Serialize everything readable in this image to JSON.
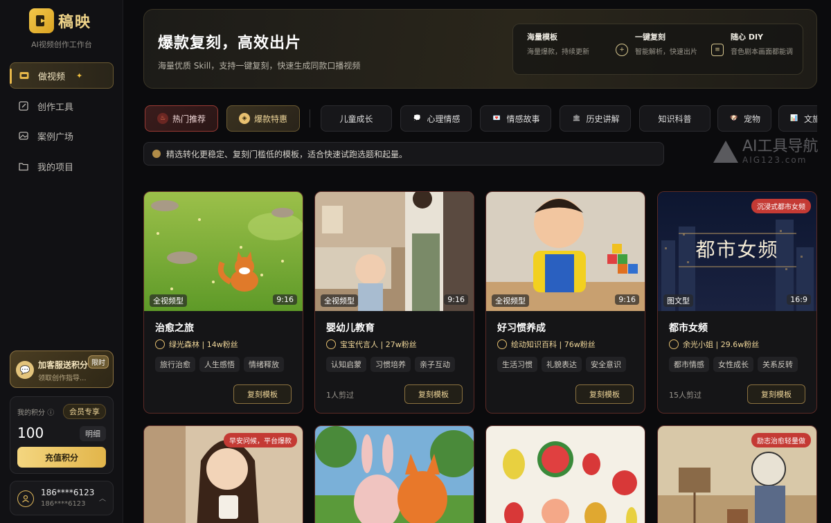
{
  "brand": {
    "name": "稿映",
    "subtitle": "AI视频创作工作台"
  },
  "nav": [
    {
      "label": "做视频",
      "icon": "video-icon"
    },
    {
      "label": "创作工具",
      "icon": "edit-icon"
    },
    {
      "label": "案例广场",
      "icon": "gallery-icon"
    },
    {
      "label": "我的项目",
      "icon": "folder-icon"
    }
  ],
  "promo": {
    "title": "加客服送积分",
    "sub": "领取创作指导...",
    "badge": "限时"
  },
  "points": {
    "label": "我的积分",
    "vip": "会员专享",
    "value": "100",
    "detail": "明细",
    "recharge": "充值积分"
  },
  "user": {
    "name": "186****6123",
    "sub": "186****6123"
  },
  "hero": {
    "title": "爆款复刻，高效出片",
    "sub": "海量优质 Skill，支持一键复刻，快速生成同款口播视频",
    "features": [
      {
        "title": "海量模板",
        "desc": "海量爆款，持续更新"
      },
      {
        "title": "一键复刻",
        "desc": "智能解析，快速出片"
      },
      {
        "title": "随心 DIY",
        "desc": "音色剧本画面都能调"
      }
    ]
  },
  "tabs": [
    "热门推荐",
    "爆款特惠",
    "儿童成长",
    "心理情感",
    "情感故事",
    "历史讲解",
    "知识科普",
    "宠物",
    "文旅"
  ],
  "info": "精选转化更稳定、复刻门槛低的模板，适合快速试跑选题和起量。",
  "watermark": {
    "main": "AI工具导航",
    "sub": "AIG123.com"
  },
  "cards": [
    {
      "title": "治愈之旅",
      "author": "绿光森林 | 14w粉丝",
      "type": "全视频型",
      "ratio": "9:16",
      "tags": [
        "旅行治愈",
        "人生感悟",
        "情绪释放"
      ],
      "count": "",
      "btn": "复刻模板",
      "badge": ""
    },
    {
      "title": "婴幼儿教育",
      "author": "宝宝代言人 | 27w粉丝",
      "type": "全视频型",
      "ratio": "9:16",
      "tags": [
        "认知启蒙",
        "习惯培养",
        "亲子互动"
      ],
      "count": "1人剪过",
      "btn": "复刻模板",
      "badge": ""
    },
    {
      "title": "好习惯养成",
      "author": "绘动知识百科 | 76w粉丝",
      "type": "全视频型",
      "ratio": "9:16",
      "tags": [
        "生活习惯",
        "礼貌表达",
        "安全意识"
      ],
      "count": "",
      "btn": "复刻模板",
      "badge": ""
    },
    {
      "title": "都市女频",
      "author": "余光小姐 | 29.6w粉丝",
      "type": "图文型",
      "ratio": "16:9",
      "tags": [
        "都市情感",
        "女性成长",
        "关系反转"
      ],
      "count": "15人剪过",
      "btn": "复刻模板",
      "badge": "沉浸式都市女频",
      "overlay": "都市女频"
    }
  ],
  "row2": [
    {
      "badge": "早安问候，平台爆款"
    },
    {
      "badge": ""
    },
    {
      "badge": ""
    },
    {
      "badge": "励志治愈轻量做"
    }
  ],
  "colors": {
    "accent": "#e8b84a",
    "hot": "#c43a34"
  }
}
